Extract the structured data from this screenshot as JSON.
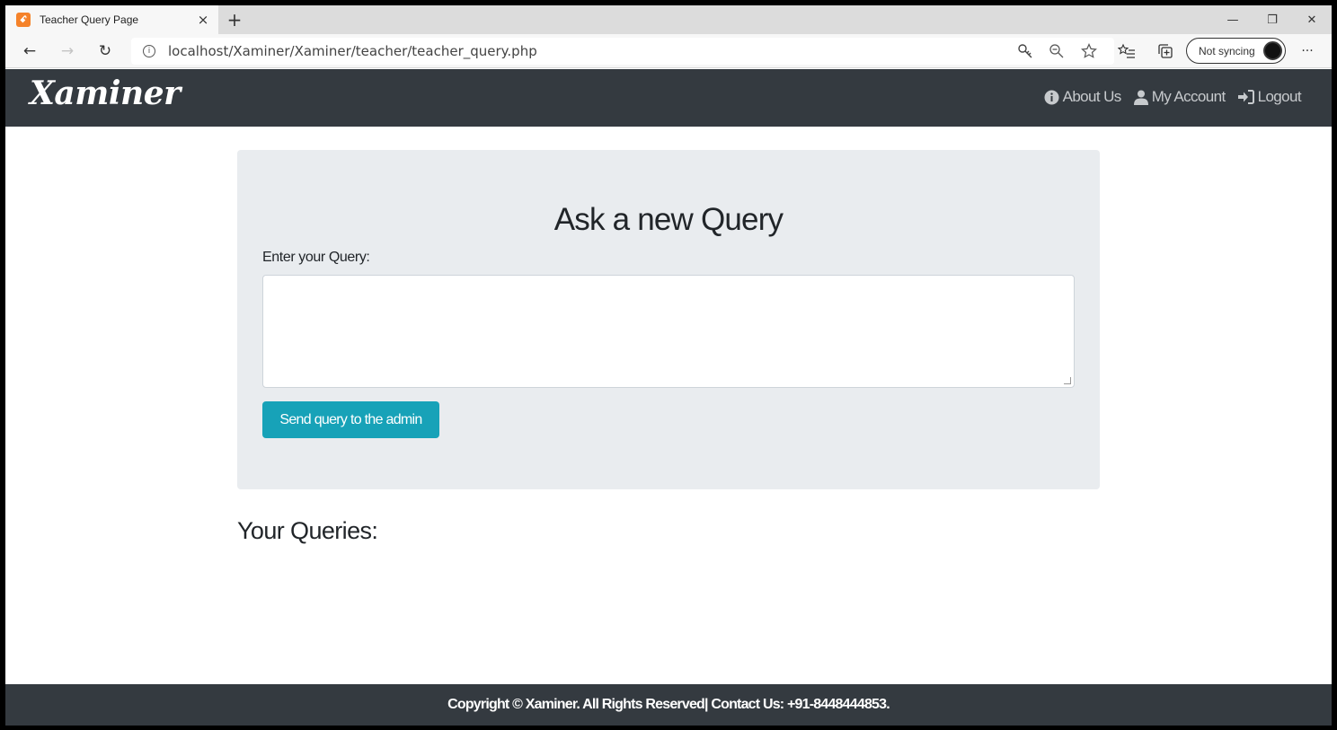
{
  "browser": {
    "tab_title": "Teacher Query Page",
    "tab_favicon": "xampp-icon",
    "tab_close": "×",
    "new_tab": "+",
    "url": "localhost/Xaminer/Xaminer/teacher/teacher_query.php",
    "sync_label": "Not syncing",
    "window_controls": {
      "minimize": "—",
      "restore": "❐",
      "close": "✕"
    },
    "nav": {
      "back": "←",
      "forward": "→",
      "refresh": "↻",
      "more": "···"
    }
  },
  "navbar": {
    "brand": "Xaminer",
    "links": [
      {
        "label": "About Us",
        "icon": "info-circle-icon"
      },
      {
        "label": "My Account",
        "icon": "user-icon"
      },
      {
        "label": "Logout",
        "icon": "sign-out-icon"
      }
    ]
  },
  "query_form": {
    "title": "Ask a new Query",
    "label": "Enter your Query:",
    "textarea_value": "",
    "submit_label": "Send query to the admin"
  },
  "queries_section": {
    "heading": "Your Queries:"
  },
  "footer": {
    "text": "Copyright © Xaminer. All Rights Reserved| Contact Us: +91-8448444853."
  },
  "colors": {
    "navbar_bg": "#343a40",
    "jumbotron_bg": "#e9ecef",
    "button_info": "#17a2b8",
    "nav_link": "#c7cacd"
  }
}
